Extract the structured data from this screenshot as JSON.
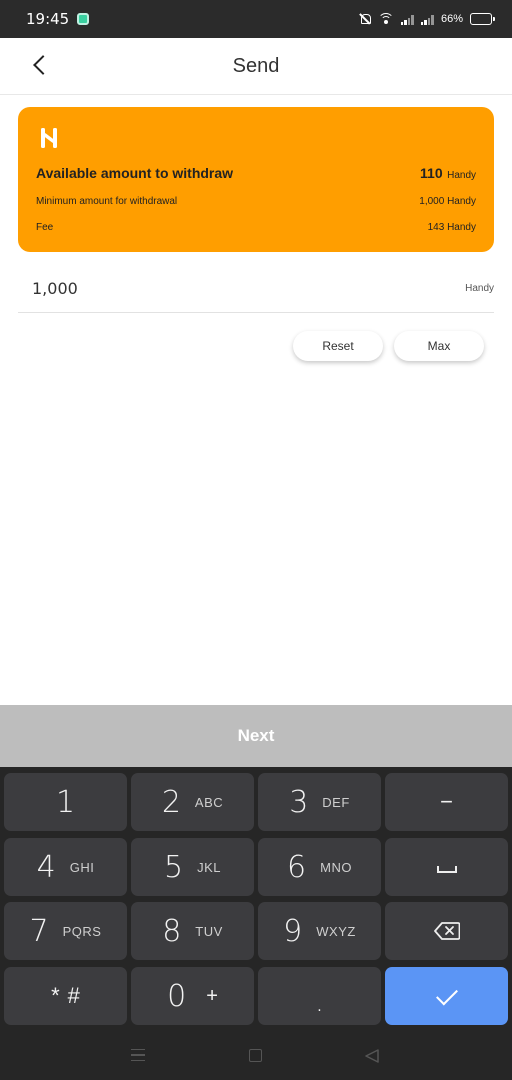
{
  "status": {
    "time": "19:45",
    "battery": "66%",
    "battery_level": 0.66
  },
  "header": {
    "title": "Send",
    "back_icon": "chevron-left-icon"
  },
  "card": {
    "logo": "handy-logo-icon",
    "available_label": "Available amount to withdraw",
    "available_value": "110",
    "available_unit": "Handy",
    "minimum_label": "Minimum amount for withdrawal",
    "minimum_value": "1,000 Handy",
    "fee_label": "Fee",
    "fee_value": "143 Handy",
    "color": "#ff9e00"
  },
  "amount": {
    "value": "1,000",
    "unit": "Handy"
  },
  "buttons": {
    "reset": "Reset",
    "max": "Max"
  },
  "keyboard": {
    "next_label": "Next",
    "keys": [
      {
        "digit": "1",
        "letters": ""
      },
      {
        "digit": "2",
        "letters": "ABC"
      },
      {
        "digit": "3",
        "letters": "DEF"
      },
      {
        "digit": "4",
        "letters": "GHI"
      },
      {
        "digit": "5",
        "letters": "JKL"
      },
      {
        "digit": "6",
        "letters": "MNO"
      },
      {
        "digit": "7",
        "letters": "PQRS"
      },
      {
        "digit": "8",
        "letters": "TUV"
      },
      {
        "digit": "9",
        "letters": "WXYZ"
      },
      {
        "digit": "*",
        "letters": "#"
      },
      {
        "digit": "0",
        "letters": "+"
      },
      {
        "digit": ".",
        "letters": ""
      }
    ],
    "minus": "−",
    "enter_color": "#5b95f5"
  }
}
